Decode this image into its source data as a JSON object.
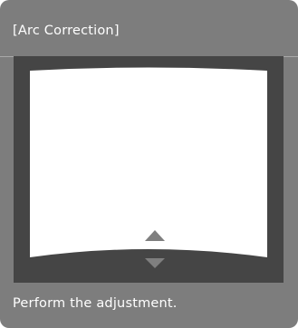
{
  "dialog": {
    "title": "[Arc Correction]",
    "instruction": "Perform the adjustment."
  },
  "icons": {
    "up": "up-triangle-icon",
    "down": "down-triangle-icon"
  },
  "colors": {
    "panel": "#7d7d7d",
    "preview_frame": "#454545",
    "screen": "#ffffff",
    "arrow": "#7f7f7f"
  }
}
